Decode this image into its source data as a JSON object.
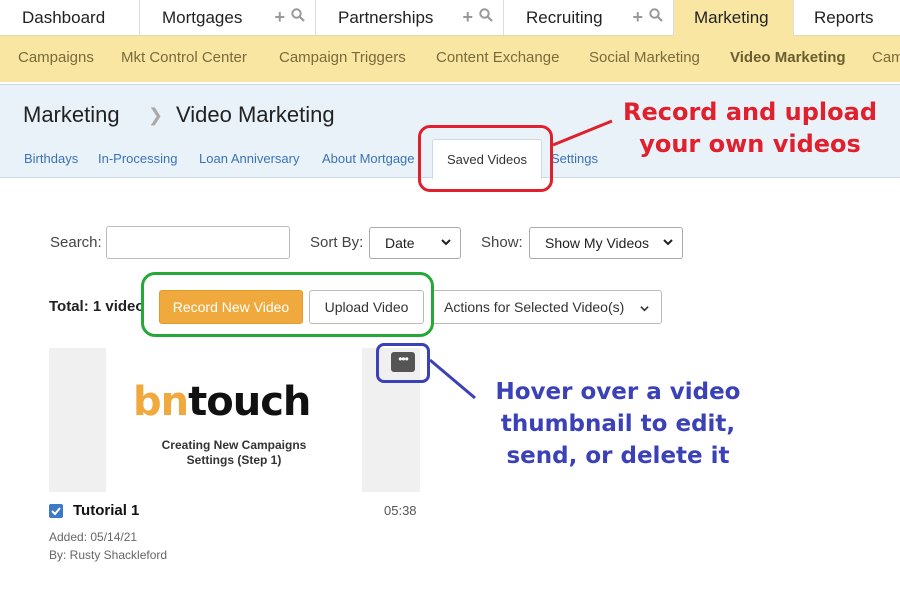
{
  "topnav": [
    {
      "label": "Dashboard",
      "active": false
    },
    {
      "label": "Mortgages",
      "active": false
    },
    {
      "label": "Partnerships",
      "active": false
    },
    {
      "label": "Recruiting",
      "active": false
    },
    {
      "label": "Marketing",
      "active": true
    },
    {
      "label": "Reports",
      "active": false
    }
  ],
  "subnav": [
    "Campaigns",
    "Mkt Control Center",
    "Campaign Triggers",
    "Content Exchange",
    "Social Marketing",
    "Video Marketing",
    "Cam"
  ],
  "breadcrumb": {
    "root": "Marketing",
    "current": "Video Marketing"
  },
  "header_tabs": [
    "Birthdays",
    "In-Processing",
    "Loan Anniversary",
    "About Mortgage",
    "Saved Videos",
    "Settings"
  ],
  "annotations": {
    "red": [
      "Record and upload",
      "your own videos"
    ],
    "blue": [
      "Hover over a video",
      "thumbnail to edit,",
      "send, or delete it"
    ]
  },
  "controls": {
    "search_label": "Search:",
    "search_value": "",
    "sort_label": "Sort By:",
    "sort_value": "Date",
    "show_label": "Show:",
    "show_value": "Show My Videos"
  },
  "toolbar": {
    "total": "Total: 1 video",
    "record": "Record New Video",
    "upload": "Upload Video",
    "actions": "Actions for Selected Video(s)"
  },
  "video": {
    "logo_bn": "bn",
    "logo_touch": "touch",
    "caption_line1": "Creating New Campaigns",
    "caption_line2": "Settings (Step 1)",
    "more": "•••",
    "title": "Tutorial 1",
    "duration": "05:38",
    "added": "Added: 05/14/21",
    "by": "By: Rusty Shackleford"
  },
  "colors": {
    "accent": "#f0a93c",
    "nav_bg": "#f9e6a3",
    "annotation_red": "#e0202c",
    "annotation_green": "#25a838",
    "annotation_blue": "#3b41b6"
  }
}
